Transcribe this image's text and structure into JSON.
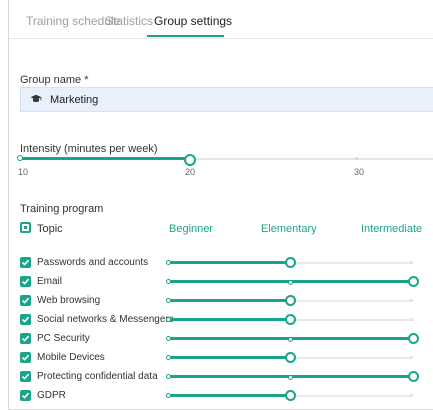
{
  "tabs": [
    {
      "label": "Training schedule",
      "active": false
    },
    {
      "label": "Statistics",
      "active": false
    },
    {
      "label": "Group settings",
      "active": true
    }
  ],
  "group_name": {
    "label": "Group name *",
    "value": "Marketing"
  },
  "intensity": {
    "label": "Intensity (minutes per week)",
    "ticks": [
      "10",
      "20",
      "30"
    ],
    "value": 20
  },
  "training_program": {
    "label": "Training program",
    "topic_header": "Topic",
    "levels": [
      "Beginner",
      "Elementary",
      "Intermediate"
    ],
    "topics": [
      {
        "label": "Passwords and accounts",
        "checked": true,
        "level": "Elementary"
      },
      {
        "label": "Email",
        "checked": true,
        "level": "Intermediate"
      },
      {
        "label": "Web browsing",
        "checked": true,
        "level": "Elementary"
      },
      {
        "label": "Social networks & Messengers",
        "checked": true,
        "level": "Elementary"
      },
      {
        "label": "PC Security",
        "checked": true,
        "level": "Intermediate"
      },
      {
        "label": "Mobile Devices",
        "checked": true,
        "level": "Elementary"
      },
      {
        "label": "Protecting confidential data",
        "checked": true,
        "level": "Intermediate"
      },
      {
        "label": "GDPR",
        "checked": true,
        "level": "Elementary"
      }
    ]
  },
  "colors": {
    "accent": "#1aa58a",
    "field_bg": "#e7f0fb",
    "track": "#e9e9e9"
  }
}
